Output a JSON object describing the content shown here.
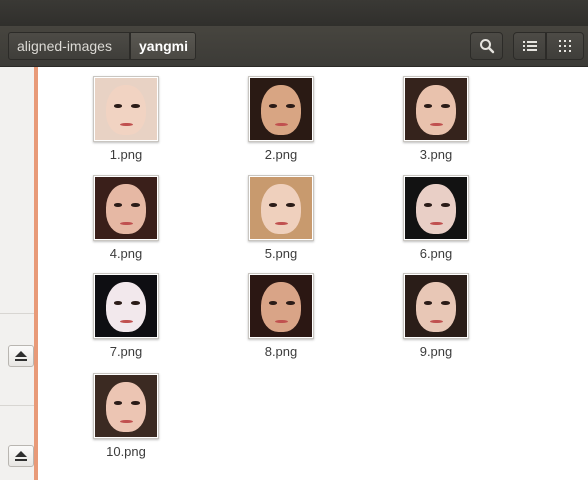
{
  "breadcrumbs": [
    {
      "label": "aligned-images"
    },
    {
      "label": "yangmi"
    }
  ],
  "toolbar": {
    "search_icon": "search-icon",
    "list_view_icon": "list-view-icon",
    "grid_view_icon": "grid-view-icon"
  },
  "sidebar": {
    "eject_icon": "eject-icon"
  },
  "files": [
    {
      "name": "1.png",
      "hair": "#e8d2c4",
      "skin": "#f1d3c2"
    },
    {
      "name": "2.png",
      "hair": "#2a1a14",
      "skin": "#d8a583"
    },
    {
      "name": "3.png",
      "hair": "#35231c",
      "skin": "#e9c2ad"
    },
    {
      "name": "4.png",
      "hair": "#3a1f1a",
      "skin": "#e6b8a4"
    },
    {
      "name": "5.png",
      "hair": "#c89a6e",
      "skin": "#efd0bd"
    },
    {
      "name": "6.png",
      "hair": "#121212",
      "skin": "#e9cfc6"
    },
    {
      "name": "7.png",
      "hair": "#0e0e12",
      "skin": "#f2e8ec"
    },
    {
      "name": "8.png",
      "hair": "#2b1713",
      "skin": "#d9a487"
    },
    {
      "name": "9.png",
      "hair": "#2a1d18",
      "skin": "#e8c7b6"
    },
    {
      "name": "10.png",
      "hair": "#3b2a22",
      "skin": "#ecc5b3"
    }
  ]
}
